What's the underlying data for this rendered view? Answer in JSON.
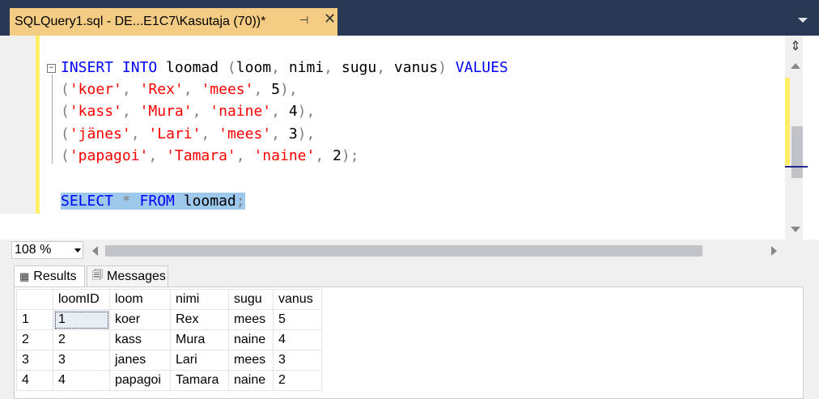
{
  "tab": {
    "title": "SQLQuery1.sql - DE...E1C7\\Kasutaja (70))*",
    "pin_icon": "pin-icon",
    "close_icon": "close-icon"
  },
  "editor": {
    "lines": [
      {
        "kw1": "INSERT INTO",
        "rest": " loomad ",
        "p1": "(",
        "cols": "loom, nimi, sugu, vanus",
        "p2": ")",
        "kw2": " VALUES"
      },
      {
        "row": [
          "'koer'",
          "'Rex'",
          "'mees'",
          "5"
        ]
      },
      {
        "row": [
          "'kass'",
          "'Mura'",
          "'naine'",
          "4"
        ]
      },
      {
        "row": [
          "'jänes'",
          "'Lari'",
          "'mees'",
          "3"
        ]
      },
      {
        "row": [
          "'papagoi'",
          "'Tamara'",
          "'naine'",
          "2"
        ]
      },
      {
        "select_kw": "SELECT",
        "star": " * ",
        "from_kw": "FROM",
        "table": " loomad",
        "semi": ";"
      }
    ]
  },
  "zoom": {
    "value": "108 %"
  },
  "results": {
    "tabs": [
      {
        "label": "Results",
        "icon": "grid-icon"
      },
      {
        "label": "Messages",
        "icon": "messages-icon"
      }
    ],
    "columns": [
      "loomID",
      "loom",
      "nimi",
      "sugu",
      "vanus"
    ],
    "rows": [
      {
        "n": "1",
        "cells": [
          "1",
          "koer",
          "Rex",
          "mees",
          "5"
        ]
      },
      {
        "n": "2",
        "cells": [
          "2",
          "kass",
          "Mura",
          "naine",
          "4"
        ]
      },
      {
        "n": "3",
        "cells": [
          "3",
          "janes",
          "Lari",
          "mees",
          "3"
        ]
      },
      {
        "n": "4",
        "cells": [
          "4",
          "papagoi",
          "Tamara",
          "naine",
          "2"
        ]
      }
    ]
  }
}
